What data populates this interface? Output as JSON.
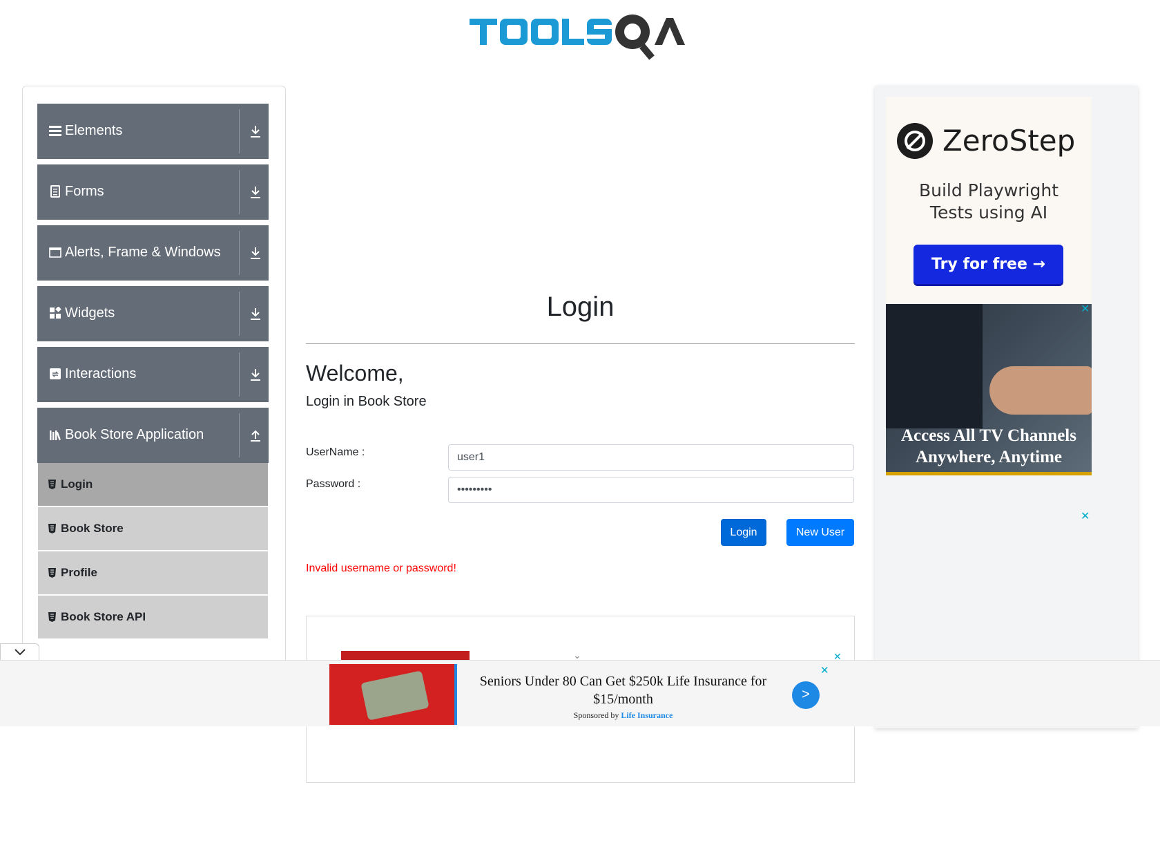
{
  "header": {
    "logo_text": "TOOLSQA"
  },
  "sidebar": {
    "groups": [
      {
        "label": "Elements",
        "icon": "list-icon",
        "arrow": "expand-arrow-icon"
      },
      {
        "label": "Forms",
        "icon": "form-icon",
        "arrow": "expand-arrow-icon"
      },
      {
        "label": "Alerts, Frame & Windows",
        "icon": "window-icon",
        "arrow": "expand-arrow-icon"
      },
      {
        "label": "Widgets",
        "icon": "widgets-icon",
        "arrow": "expand-arrow-icon"
      },
      {
        "label": "Interactions",
        "icon": "interactions-icon",
        "arrow": "expand-arrow-icon"
      },
      {
        "label": "Book Store Application",
        "icon": "books-icon",
        "arrow": "collapse-arrow-icon"
      }
    ],
    "book_store_items": [
      {
        "label": "Login",
        "active": true
      },
      {
        "label": "Book Store",
        "active": false
      },
      {
        "label": "Profile",
        "active": false
      },
      {
        "label": "Book Store API",
        "active": false
      }
    ]
  },
  "main": {
    "page_title": "Login",
    "welcome": "Welcome,",
    "subtitle": "Login in Book Store",
    "username_label": "UserName :",
    "username_value": "user1",
    "password_label": "Password :",
    "password_value": "•••••••••",
    "login_button": "Login",
    "new_user_button": "New User",
    "error_message": "Invalid username or password!"
  },
  "ads": {
    "zerostep": {
      "brand": "ZeroStep",
      "tagline_line1": "Build Playwright",
      "tagline_line2": "Tests using AI",
      "cta": "Try for free →"
    },
    "tv": {
      "line1": "Access All TV Channels",
      "line2": "Anywhere, Anytime"
    },
    "bottom": {
      "headline_line1": "Seniors Under 80 Can Get $250k Life Insurance for",
      "headline_line2": "$15/month",
      "sponsored_by": "Sponsored by",
      "sponsor": "Life Insurance",
      "go": ">"
    },
    "close_glyph": "✕"
  },
  "colors": {
    "sidebar_group_bg": "#646d77",
    "sidebar_sub_bg": "#cfcfcf",
    "sidebar_active_bg": "#a8a8a8",
    "primary": "#007bff",
    "error": "#ff0000",
    "logo_blue": "#1b9ad6",
    "logo_dark": "#333333"
  }
}
